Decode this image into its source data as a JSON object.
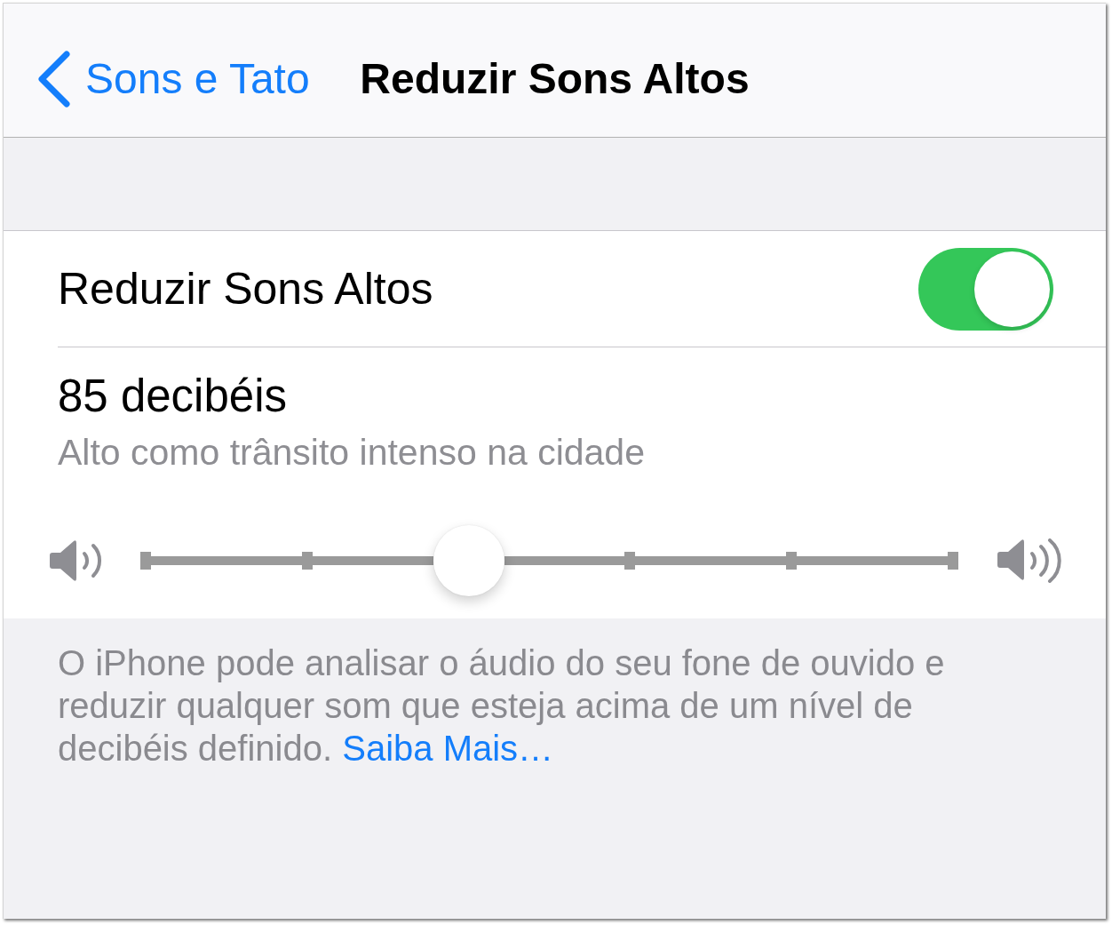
{
  "nav_bar": {
    "back_label": "Sons e Tato",
    "title": "Reduzir Sons Altos"
  },
  "settings": {
    "toggle": {
      "label": "Reduzir Sons Altos",
      "on": true
    },
    "level_row": {
      "value": "85 decibéis",
      "description": "Alto como trânsito intenso na cidade",
      "slider": {
        "level": 0.4
      }
    }
  },
  "footer": {
    "text": "O iPhone pode analisar o áudio do seu fone de ouvido e reduzir qualquer som que esteja acima de um nível de decibéis definido.",
    "link": "Saiba Mais…"
  }
}
